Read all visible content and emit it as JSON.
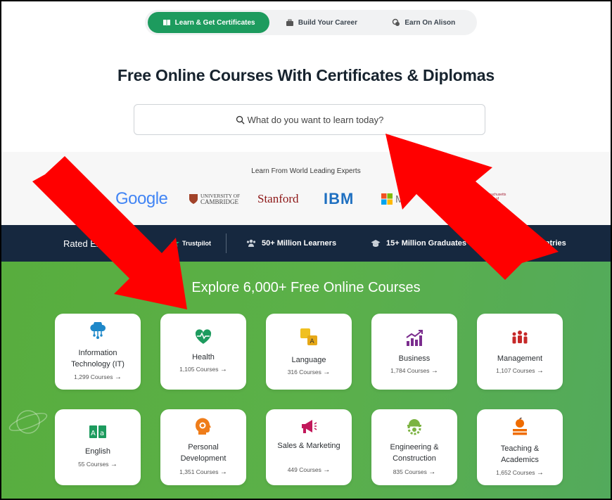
{
  "tabs": [
    {
      "label": "Learn & Get Certificates",
      "active": true
    },
    {
      "label": "Build Your Career"
    },
    {
      "label": "Earn On Alison"
    }
  ],
  "hero": {
    "title": "Free Online Courses With Certificates & Diplomas",
    "search_placeholder": "What do you want to learn today?"
  },
  "experts": {
    "label": "Learn From World Leading Experts",
    "logos": {
      "google": "Google",
      "cambridge_1": "UNIVERSITY OF",
      "cambridge_2": "CAMBRIDGE",
      "stanford": "Stanford",
      "ibm": "IBM",
      "microsoft": "M",
      "mit": "Massachusetts Institute of Technology"
    }
  },
  "stats": {
    "rated": "Rated Exc",
    "trustpilot": "Trustpilot",
    "learners": "50+ Million Learners",
    "graduates": "15+ Million Graduates",
    "countries": "193 Countries"
  },
  "courses": {
    "title": "Explore 6,000+ Free Online Courses",
    "items": [
      {
        "name": "Information Technology (IT)",
        "count": "1,299 Courses"
      },
      {
        "name": "Health",
        "count": "1,105 Courses"
      },
      {
        "name": "Language",
        "count": "316 Courses"
      },
      {
        "name": "Business",
        "count": "1,784 Courses"
      },
      {
        "name": "Management",
        "count": "1,107 Courses"
      },
      {
        "name": "English",
        "count": "55 Courses"
      },
      {
        "name": "Personal Development",
        "count": "1,351 Courses"
      },
      {
        "name": "Sales & Marketing",
        "count": "449 Courses"
      },
      {
        "name": "Engineering & Construction",
        "count": "835 Courses"
      },
      {
        "name": "Teaching & Academics",
        "count": "1,652 Courses"
      }
    ]
  },
  "colors": {
    "primary_green": "#1d9b5e",
    "navy": "#16283f",
    "annotation_red": "#ff0000"
  }
}
